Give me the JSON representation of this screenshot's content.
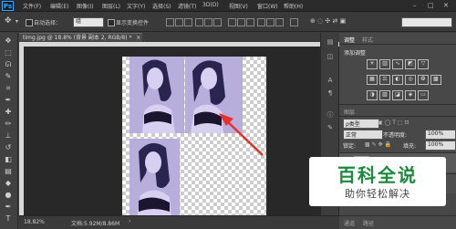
{
  "app": {
    "logo": "Ps"
  },
  "menu": [
    "文件(F)",
    "编辑(E)",
    "图像(I)",
    "图层(L)",
    "文字(Y)",
    "选择(S)",
    "滤镜(T)",
    "3D(D)",
    "视图(V)",
    "窗口(W)",
    "帮助(H)"
  ],
  "window_controls": {
    "min": "–",
    "max": "□",
    "close": "✕"
  },
  "options": {
    "auto_select_label": "自动选择：",
    "auto_select_value": "组",
    "show_transform_label": "显示变换控件"
  },
  "document_tab": {
    "title": "timg.jpg @ 18.8% (背景 副本 2, RGB/8) *",
    "close": "×"
  },
  "status": {
    "zoom": "18.82%",
    "doc_info": "文档:5.92M/8.86M",
    "arrow": "›"
  },
  "panels": {
    "adjust_tab": "调整",
    "style_tab": "样式",
    "add_adjustment": "添加调整",
    "layers_section": "图层",
    "kind_label": "ρ类型",
    "blend_mode": "正常",
    "opacity_label": "不透明度:",
    "opacity_value": "100%",
    "lock_label": "锁定:",
    "fill_label": "填充:",
    "fill_value": "100%",
    "bottom_tabs": [
      "通道",
      "路径"
    ]
  },
  "watermark": {
    "title": "百科全说",
    "subtitle": "助你轻松解决",
    "title_color": "#1a8a3c"
  },
  "colors": {
    "accent": "#31a8ff",
    "arrow": "#e8302a"
  }
}
